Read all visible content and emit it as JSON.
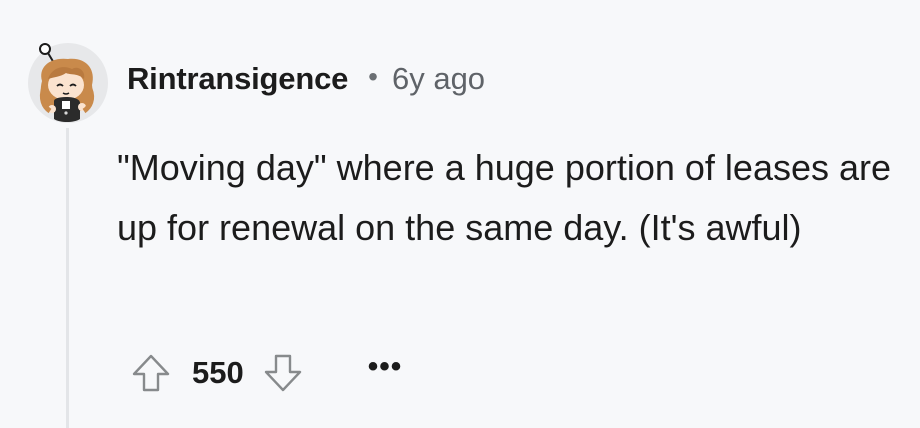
{
  "comment": {
    "username": "Rintransigence",
    "separator": "•",
    "time": "6y ago",
    "body": "\"Moving day\" where a huge portion of leases are up for renewal on the same day. (It's awful)",
    "score": "550",
    "more_label": "•••"
  }
}
